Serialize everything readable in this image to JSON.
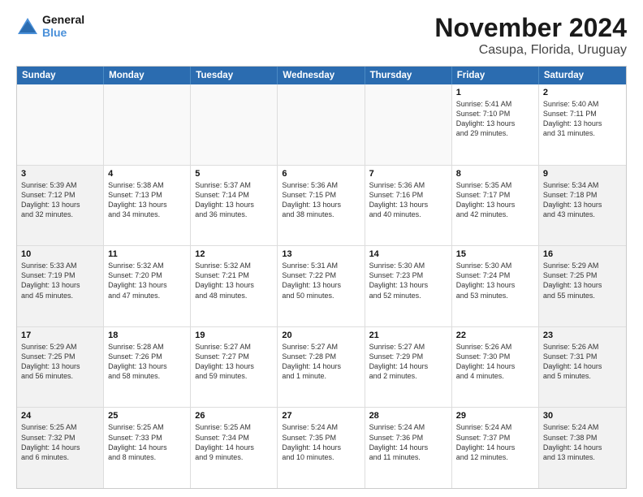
{
  "logo": {
    "line1": "General",
    "line2": "Blue"
  },
  "title": "November 2024",
  "subtitle": "Casupa, Florida, Uruguay",
  "header_days": [
    "Sunday",
    "Monday",
    "Tuesday",
    "Wednesday",
    "Thursday",
    "Friday",
    "Saturday"
  ],
  "weeks": [
    [
      {
        "day": "",
        "text": "",
        "shaded": true
      },
      {
        "day": "",
        "text": "",
        "shaded": true
      },
      {
        "day": "",
        "text": "",
        "shaded": true
      },
      {
        "day": "",
        "text": "",
        "shaded": true
      },
      {
        "day": "",
        "text": "",
        "shaded": true
      },
      {
        "day": "1",
        "text": "Sunrise: 5:41 AM\nSunset: 7:10 PM\nDaylight: 13 hours\nand 29 minutes.",
        "shaded": false
      },
      {
        "day": "2",
        "text": "Sunrise: 5:40 AM\nSunset: 7:11 PM\nDaylight: 13 hours\nand 31 minutes.",
        "shaded": false
      }
    ],
    [
      {
        "day": "3",
        "text": "Sunrise: 5:39 AM\nSunset: 7:12 PM\nDaylight: 13 hours\nand 32 minutes.",
        "shaded": true
      },
      {
        "day": "4",
        "text": "Sunrise: 5:38 AM\nSunset: 7:13 PM\nDaylight: 13 hours\nand 34 minutes.",
        "shaded": false
      },
      {
        "day": "5",
        "text": "Sunrise: 5:37 AM\nSunset: 7:14 PM\nDaylight: 13 hours\nand 36 minutes.",
        "shaded": false
      },
      {
        "day": "6",
        "text": "Sunrise: 5:36 AM\nSunset: 7:15 PM\nDaylight: 13 hours\nand 38 minutes.",
        "shaded": false
      },
      {
        "day": "7",
        "text": "Sunrise: 5:36 AM\nSunset: 7:16 PM\nDaylight: 13 hours\nand 40 minutes.",
        "shaded": false
      },
      {
        "day": "8",
        "text": "Sunrise: 5:35 AM\nSunset: 7:17 PM\nDaylight: 13 hours\nand 42 minutes.",
        "shaded": false
      },
      {
        "day": "9",
        "text": "Sunrise: 5:34 AM\nSunset: 7:18 PM\nDaylight: 13 hours\nand 43 minutes.",
        "shaded": true
      }
    ],
    [
      {
        "day": "10",
        "text": "Sunrise: 5:33 AM\nSunset: 7:19 PM\nDaylight: 13 hours\nand 45 minutes.",
        "shaded": true
      },
      {
        "day": "11",
        "text": "Sunrise: 5:32 AM\nSunset: 7:20 PM\nDaylight: 13 hours\nand 47 minutes.",
        "shaded": false
      },
      {
        "day": "12",
        "text": "Sunrise: 5:32 AM\nSunset: 7:21 PM\nDaylight: 13 hours\nand 48 minutes.",
        "shaded": false
      },
      {
        "day": "13",
        "text": "Sunrise: 5:31 AM\nSunset: 7:22 PM\nDaylight: 13 hours\nand 50 minutes.",
        "shaded": false
      },
      {
        "day": "14",
        "text": "Sunrise: 5:30 AM\nSunset: 7:23 PM\nDaylight: 13 hours\nand 52 minutes.",
        "shaded": false
      },
      {
        "day": "15",
        "text": "Sunrise: 5:30 AM\nSunset: 7:24 PM\nDaylight: 13 hours\nand 53 minutes.",
        "shaded": false
      },
      {
        "day": "16",
        "text": "Sunrise: 5:29 AM\nSunset: 7:25 PM\nDaylight: 13 hours\nand 55 minutes.",
        "shaded": true
      }
    ],
    [
      {
        "day": "17",
        "text": "Sunrise: 5:29 AM\nSunset: 7:25 PM\nDaylight: 13 hours\nand 56 minutes.",
        "shaded": true
      },
      {
        "day": "18",
        "text": "Sunrise: 5:28 AM\nSunset: 7:26 PM\nDaylight: 13 hours\nand 58 minutes.",
        "shaded": false
      },
      {
        "day": "19",
        "text": "Sunrise: 5:27 AM\nSunset: 7:27 PM\nDaylight: 13 hours\nand 59 minutes.",
        "shaded": false
      },
      {
        "day": "20",
        "text": "Sunrise: 5:27 AM\nSunset: 7:28 PM\nDaylight: 14 hours\nand 1 minute.",
        "shaded": false
      },
      {
        "day": "21",
        "text": "Sunrise: 5:27 AM\nSunset: 7:29 PM\nDaylight: 14 hours\nand 2 minutes.",
        "shaded": false
      },
      {
        "day": "22",
        "text": "Sunrise: 5:26 AM\nSunset: 7:30 PM\nDaylight: 14 hours\nand 4 minutes.",
        "shaded": false
      },
      {
        "day": "23",
        "text": "Sunrise: 5:26 AM\nSunset: 7:31 PM\nDaylight: 14 hours\nand 5 minutes.",
        "shaded": true
      }
    ],
    [
      {
        "day": "24",
        "text": "Sunrise: 5:25 AM\nSunset: 7:32 PM\nDaylight: 14 hours\nand 6 minutes.",
        "shaded": true
      },
      {
        "day": "25",
        "text": "Sunrise: 5:25 AM\nSunset: 7:33 PM\nDaylight: 14 hours\nand 8 minutes.",
        "shaded": false
      },
      {
        "day": "26",
        "text": "Sunrise: 5:25 AM\nSunset: 7:34 PM\nDaylight: 14 hours\nand 9 minutes.",
        "shaded": false
      },
      {
        "day": "27",
        "text": "Sunrise: 5:24 AM\nSunset: 7:35 PM\nDaylight: 14 hours\nand 10 minutes.",
        "shaded": false
      },
      {
        "day": "28",
        "text": "Sunrise: 5:24 AM\nSunset: 7:36 PM\nDaylight: 14 hours\nand 11 minutes.",
        "shaded": false
      },
      {
        "day": "29",
        "text": "Sunrise: 5:24 AM\nSunset: 7:37 PM\nDaylight: 14 hours\nand 12 minutes.",
        "shaded": false
      },
      {
        "day": "30",
        "text": "Sunrise: 5:24 AM\nSunset: 7:38 PM\nDaylight: 14 hours\nand 13 minutes.",
        "shaded": true
      }
    ]
  ]
}
